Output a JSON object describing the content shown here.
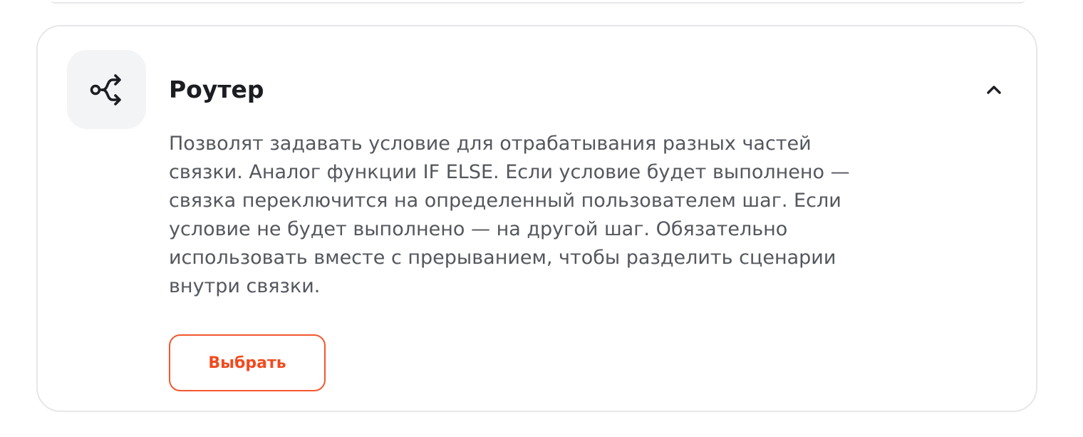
{
  "module": {
    "icon": "router-branch-icon",
    "title": "Роутер",
    "collapse_icon": "chevron-up-icon",
    "description": "Позволят задавать условие для отрабатывания разных частей связки. Аналог функции IF ELSE. Если условие будет выполнено — связка переключится на определенный пользователем шаг. Если условие не будет выполнено — на другой шаг. Обязательно использовать вместе с прерыванием, чтобы разделить сценарии внутри связки.",
    "select_label": "Выбрать"
  },
  "colors": {
    "accent": "#f14a1f",
    "title_text": "#1b1d21",
    "body_text": "#54575d",
    "card_border": "#e6e7ea",
    "icon_tile_bg": "#f3f4f6"
  }
}
